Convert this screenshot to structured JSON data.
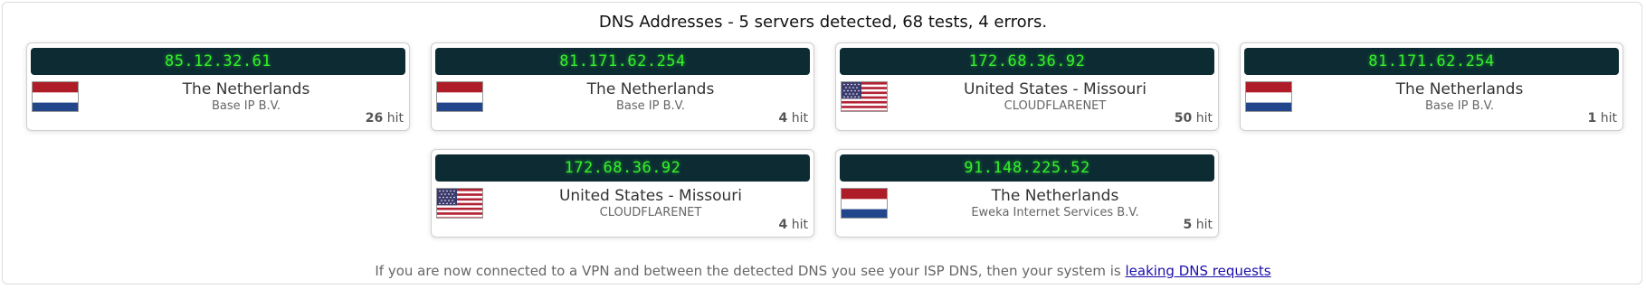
{
  "header": {
    "title": "DNS Addresses - 5 servers detected, 68 tests, 4 errors."
  },
  "cards": [
    {
      "ip": "85.12.32.61",
      "country": "The Netherlands",
      "isp": "Base IP B.V.",
      "hits": "26",
      "hit_label": "hit",
      "flag": "nl-flag-icon"
    },
    {
      "ip": "81.171.62.254",
      "country": "The Netherlands",
      "isp": "Base IP B.V.",
      "hits": "4",
      "hit_label": "hit",
      "flag": "nl-flag-icon"
    },
    {
      "ip": "172.68.36.92",
      "country": "United States - Missouri",
      "isp": "CLOUDFLARENET",
      "hits": "50",
      "hit_label": "hit",
      "flag": "us-flag-icon"
    },
    {
      "ip": "81.171.62.254",
      "country": "The Netherlands",
      "isp": "Base IP B.V.",
      "hits": "1",
      "hit_label": "hit",
      "flag": "nl-flag-icon"
    },
    {
      "ip": "172.68.36.92",
      "country": "United States - Missouri",
      "isp": "CLOUDFLARENET",
      "hits": "4",
      "hit_label": "hit",
      "flag": "us-flag-icon"
    },
    {
      "ip": "91.148.225.52",
      "country": "The Netherlands",
      "isp": "Eweka Internet Services B.V.",
      "hits": "5",
      "hit_label": "hit",
      "flag": "nl-flag-icon"
    }
  ],
  "footer": {
    "text": "If you are now connected to a VPN and between the detected DNS you see your ISP DNS, then your system is",
    "link": "leaking DNS requests"
  },
  "colors": {
    "ip_bar_bg": "#0c2b33",
    "ip_text": "#34f02a",
    "link": "#1a0dab"
  }
}
